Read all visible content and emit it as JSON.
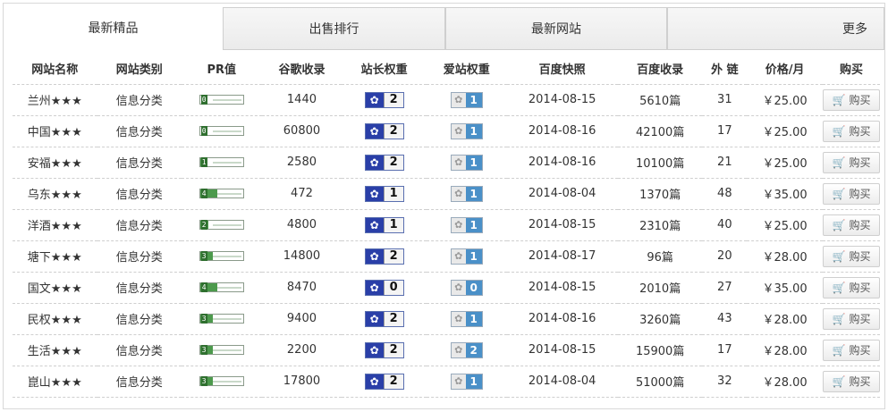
{
  "tabs": [
    {
      "label": "最新精品"
    },
    {
      "label": "出售排行"
    },
    {
      "label": "最新网站"
    },
    {
      "label": "更多"
    }
  ],
  "headers": {
    "name": "网站名称",
    "category": "网站类别",
    "pr": "PR值",
    "google": "谷歌收录",
    "baidu_weight": "站长权重",
    "aizhan_weight": "爱站权重",
    "snapshot": "百度快照",
    "baidu_index": "百度收录",
    "links": "外 链",
    "price": "价格/月",
    "buy": "购买"
  },
  "rows": [
    {
      "name": "兰州★★★",
      "category": "信息分类",
      "pr": 0,
      "google": "1440",
      "bw": "2",
      "aw": "1",
      "snapshot": "2014-08-15",
      "baidu": "5610篇",
      "links": "31",
      "price": "￥25.00",
      "buy": "购买"
    },
    {
      "name": "中国★★★",
      "category": "信息分类",
      "pr": 0,
      "google": "60800",
      "bw": "2",
      "aw": "1",
      "snapshot": "2014-08-16",
      "baidu": "42100篇",
      "links": "17",
      "price": "￥25.00",
      "buy": "购买"
    },
    {
      "name": "安福★★★",
      "category": "信息分类",
      "pr": 1,
      "google": "2580",
      "bw": "2",
      "aw": "1",
      "snapshot": "2014-08-16",
      "baidu": "10100篇",
      "links": "21",
      "price": "￥25.00",
      "buy": "购买"
    },
    {
      "name": "乌东★★★",
      "category": "信息分类",
      "pr": 4,
      "google": "472",
      "bw": "1",
      "aw": "1",
      "snapshot": "2014-08-04",
      "baidu": "1370篇",
      "links": "48",
      "price": "￥35.00",
      "buy": "购买"
    },
    {
      "name": "洋酒★★★",
      "category": "信息分类",
      "pr": 2,
      "google": "4800",
      "bw": "1",
      "aw": "1",
      "snapshot": "2014-08-15",
      "baidu": "2310篇",
      "links": "40",
      "price": "￥25.00",
      "buy": "购买"
    },
    {
      "name": "塘下★★★",
      "category": "信息分类",
      "pr": 3,
      "google": "14800",
      "bw": "2",
      "aw": "1",
      "snapshot": "2014-08-17",
      "baidu": "96篇",
      "links": "20",
      "price": "￥28.00",
      "buy": "购买"
    },
    {
      "name": "国文★★★",
      "category": "信息分类",
      "pr": 4,
      "google": "8470",
      "bw": "0",
      "aw": "0",
      "snapshot": "2014-08-15",
      "baidu": "2010篇",
      "links": "27",
      "price": "￥35.00",
      "buy": "购买"
    },
    {
      "name": "民权★★★",
      "category": "信息分类",
      "pr": 3,
      "google": "9400",
      "bw": "2",
      "aw": "1",
      "snapshot": "2014-08-16",
      "baidu": "3260篇",
      "links": "43",
      "price": "￥28.00",
      "buy": "购买"
    },
    {
      "name": "生活★★★",
      "category": "信息分类",
      "pr": 3,
      "google": "2200",
      "bw": "2",
      "aw": "2",
      "snapshot": "2014-08-15",
      "baidu": "15900篇",
      "links": "17",
      "price": "￥28.00",
      "buy": "购买"
    },
    {
      "name": "崑山★★★",
      "category": "信息分类",
      "pr": 3,
      "google": "17800",
      "bw": "2",
      "aw": "1",
      "snapshot": "2014-08-04",
      "baidu": "51000篇",
      "links": "32",
      "price": "￥28.00",
      "buy": "购买"
    }
  ],
  "icons": {
    "baidu": "paw-icon",
    "aizhan": "paw-icon",
    "cart": "cart-icon"
  },
  "colors": {
    "pr_fill": "#4c9a4c",
    "baidu_badge": "#2a3fa8",
    "aizhan_badge": "#4a90c8"
  }
}
